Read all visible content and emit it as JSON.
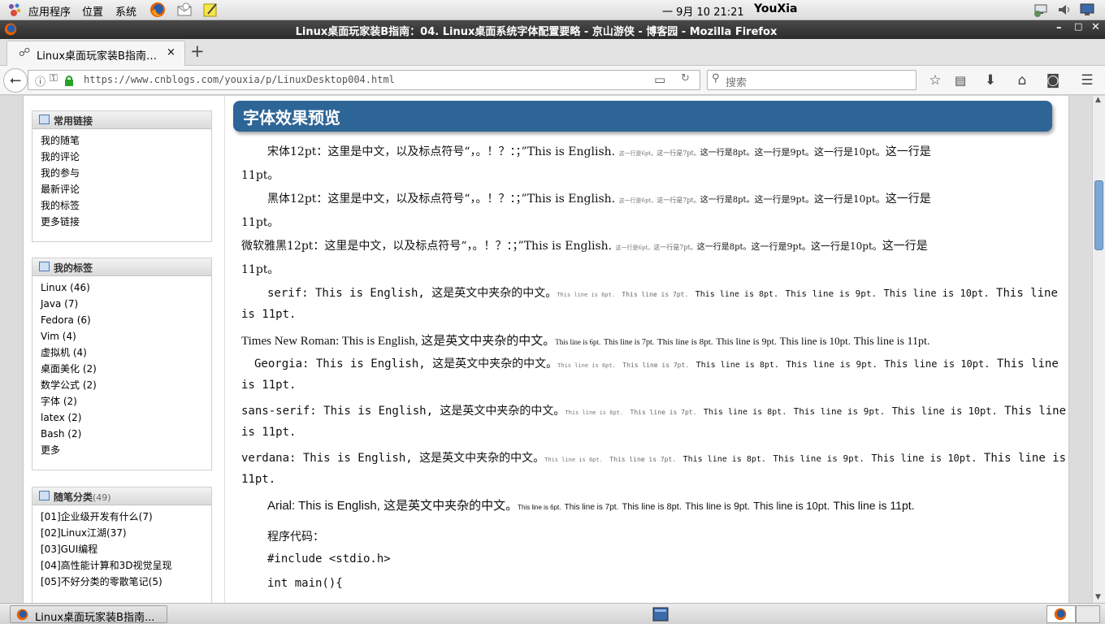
{
  "top_panel": {
    "menus": [
      "应用程序",
      "位置",
      "系统"
    ],
    "clock": "一 9月 10 21:21",
    "user": "YouXia"
  },
  "window": {
    "title": "Linux桌面玩家装B指南：04. Linux桌面系统字体配置要略 - 京山游侠 - 博客园 - Mozilla Firefox"
  },
  "tab": {
    "label": "Linux桌面玩家装B指南…",
    "close": "×",
    "new_tab": "+"
  },
  "nav": {
    "url": "https://www.cnblogs.com/youxia/p/LinuxDesktop004.html",
    "search_placeholder": "搜索"
  },
  "sidebar": {
    "boxes": [
      {
        "title": "常用链接",
        "items": [
          "我的随笔",
          "我的评论",
          "我的参与",
          "最新评论",
          "我的标签",
          "更多链接"
        ]
      },
      {
        "title": "我的标签",
        "items": [
          "Linux (46)",
          "Java (7)",
          "Fedora (6)",
          "Vim (4)",
          "虚拟机 (4)",
          "桌面美化 (2)",
          "数学公式 (2)",
          "字体 (2)",
          "latex (2)",
          "Bash (2)",
          "更多"
        ]
      },
      {
        "title": "随笔分类",
        "count": "(49)",
        "items": [
          "[01]企业级开发有什么(7)",
          "[02]Linux江湖(37)",
          "[03]GUI编程",
          "[04]高性能计算和3D视觉呈现",
          "[05]不好分类的零散笔记(5)"
        ]
      }
    ]
  },
  "content": {
    "heading": "字体效果预览",
    "cjk_lines": [
      {
        "prefix": "宋体12pt：这里是中文，以及标点符号“，。！？：；”This is English.",
        "wrap": "11pt。"
      },
      {
        "prefix": "黑体12pt：这里是中文，以及标点符号“，。！？：；”This is English.",
        "wrap": "11pt。"
      },
      {
        "prefix": "微软雅黑12pt：这里是中文，以及标点符号“，。！？：；”This is English.",
        "wrap": "11pt。"
      }
    ],
    "cjk_sizes": {
      "s6": "这一行是6pt。",
      "s7": "这一行是7pt。",
      "s8": "这一行是8pt。",
      "s9": "这一行是9pt。",
      "s10": "这一行是10pt。",
      "s11": "这一行是"
    },
    "latin_lines": [
      {
        "prefix": "serif: This is English, 这是英文中夹杂的中文。",
        "wrap": "is 11pt."
      },
      {
        "prefix": "Times New Roman: This is English, 这是英文中夹杂的中文。",
        "wrap": ""
      },
      {
        "prefix": "Georgia: This is English, 这是英文中夹杂的中文。",
        "wrap": "is 11pt."
      },
      {
        "prefix": "sans-serif: This is English, 这是英文中夹杂的中文。",
        "wrap": "is 11pt."
      },
      {
        "prefix": "verdana: This is English, 这是英文中夹杂的中文。",
        "wrap": "11pt."
      },
      {
        "prefix": "Arial: This is English, 这是英文中夹杂的中文。",
        "wrap": ""
      }
    ],
    "latin_sizes": {
      "s6": "This line is 6pt.",
      "s7": "This line is 7pt.",
      "s8": "This line is 8pt.",
      "s9": "This line is 9pt.",
      "s10": "This line is 10pt.",
      "s11": "This line",
      "s11_full": "This line is 11pt."
    },
    "code_label": "程序代码：",
    "code_lines": [
      "#include <stdio.h>",
      "int main(){"
    ]
  },
  "taskbar": {
    "window_button": "Linux桌面玩家装B指南..."
  }
}
